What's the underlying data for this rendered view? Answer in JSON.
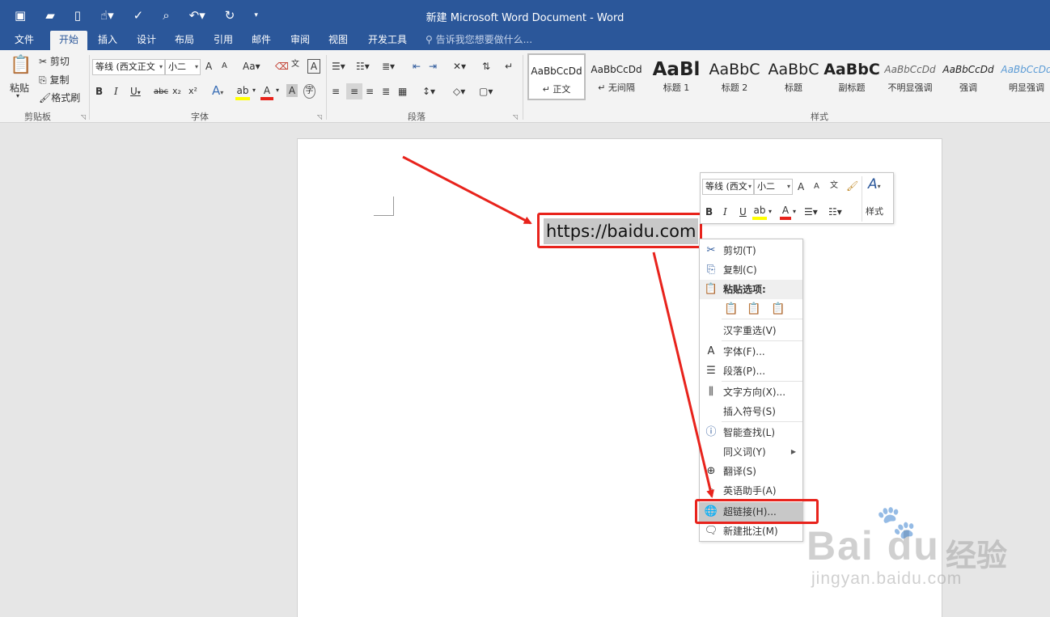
{
  "app": {
    "window_title": "新建 Microsoft Word Document - Word"
  },
  "qat": {
    "save_icon": "save-icon",
    "open_icon": "open-folder-icon",
    "new_icon": "new-doc-icon",
    "touch_icon": "touch-mode-icon",
    "spell_icon": "spelling-icon",
    "preview_icon": "print-preview-icon",
    "undo_icon": "undo-icon",
    "redo_icon": "redo-icon",
    "customize_icon": "customize-qat-icon"
  },
  "tabs": [
    "文件",
    "开始",
    "插入",
    "设计",
    "布局",
    "引用",
    "邮件",
    "审阅",
    "视图",
    "开发工具"
  ],
  "active_tab": "开始",
  "tell_me": "告诉我您想要做什么...",
  "clipboard": {
    "paste": "粘贴",
    "cut": "剪切",
    "copy": "复制",
    "format_painter": "格式刷",
    "group_label": "剪贴板"
  },
  "font": {
    "font_name": "等线 (西文正文",
    "font_size": "小二",
    "group_label": "字体",
    "bold": "B",
    "italic": "I",
    "underline": "U",
    "strike": "abc",
    "grow": "A",
    "shrink": "A",
    "case": "Aa",
    "subscript": "x₂",
    "superscript": "x²"
  },
  "paragraph": {
    "group_label": "段落"
  },
  "styles": {
    "group_label": "样式",
    "items": [
      {
        "sample": "AaBbCcDd",
        "name": "↵ 正文"
      },
      {
        "sample": "AaBbCcDd",
        "name": "↵ 无间隔"
      },
      {
        "sample": "AaBl",
        "name": "标题 1"
      },
      {
        "sample": "AaBbC",
        "name": "标题 2"
      },
      {
        "sample": "AaBbC",
        "name": "标题"
      },
      {
        "sample": "AaBbC",
        "name": "副标题"
      },
      {
        "sample": "AaBbCcDd",
        "name": "不明显强调"
      },
      {
        "sample": "AaBbCcDd",
        "name": "强调"
      },
      {
        "sample": "AaBbCcDd",
        "name": "明显强调"
      }
    ]
  },
  "document": {
    "selected_text": "https://baidu.com"
  },
  "mini_toolbar": {
    "font_name": "等线 (西文",
    "font_size": "小二",
    "styles_label": "样式",
    "bold": "B",
    "italic": "I",
    "underline": "U"
  },
  "context_menu": {
    "items": [
      {
        "icon": "scissors-icon",
        "label": "剪切(T)"
      },
      {
        "icon": "copy-icon",
        "label": "复制(C)"
      },
      {
        "icon": "paste-icon",
        "label": "粘贴选项:"
      },
      {
        "icon": "",
        "label": ""
      },
      {
        "icon": "",
        "label": "汉字重选(V)"
      },
      {
        "icon": "font-icon",
        "label": "字体(F)..."
      },
      {
        "icon": "paragraph-icon",
        "label": "段落(P)..."
      },
      {
        "icon": "text-direction-icon",
        "label": "文字方向(X)..."
      },
      {
        "icon": "",
        "label": "插入符号(S)"
      },
      {
        "icon": "smart-lookup-icon",
        "label": "智能查找(L)"
      },
      {
        "icon": "",
        "label": "同义词(Y)"
      },
      {
        "icon": "translate-icon",
        "label": "翻译(S)"
      },
      {
        "icon": "english-assistant-icon",
        "label": "英语助手(A)"
      },
      {
        "icon": "hyperlink-icon",
        "label": "超链接(H)..."
      },
      {
        "icon": "new-comment-icon",
        "label": "新建批注(M)"
      }
    ]
  },
  "watermark": {
    "brand": "Bai du",
    "cn": "经验",
    "url": "jingyan.baidu.com"
  },
  "colors": {
    "title_bar": "#2b579a",
    "highlight_red": "#e8231c",
    "selection_gray": "#c8c8c8"
  }
}
